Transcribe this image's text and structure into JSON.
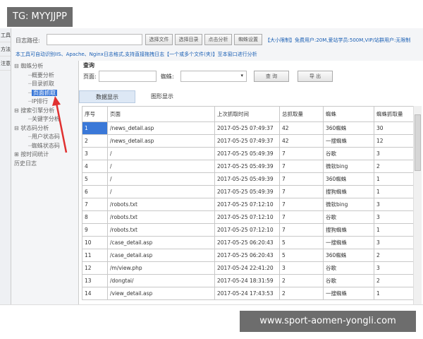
{
  "watermarks": {
    "top": "TG: MYYJJPP",
    "bottom": "www.sport-aomen-yongli.com"
  },
  "left_strip": [
    "工具/",
    "方法/",
    "注意事"
  ],
  "toolbar": {
    "log_path_label": "日志路径:",
    "log_path_value": "",
    "select_file": "选择文件",
    "select_dir": "选择目录",
    "analyze": "点击分析",
    "spider_settings": "蜘蛛设置",
    "size_limit": "【大小限制】免费用户:20M,爱站学员:500M,VIP/站群用户:无限制"
  },
  "info_text": "本工具可自动识别IIS、Apache、Nginx日志格式,支持直接拖拽日志【一个或多个文件(夹)】至本窗口进行分析",
  "tree": [
    {
      "label": "蜘蛛分析",
      "level": 0,
      "sign": "⊟"
    },
    {
      "label": "概要分析",
      "level": 1
    },
    {
      "label": "目录抓取",
      "level": 1
    },
    {
      "label": "页面抓取",
      "level": 1,
      "selected": true
    },
    {
      "label": "IP排行",
      "level": 1
    },
    {
      "label": "搜索引擎分析",
      "level": 0,
      "sign": "⊟"
    },
    {
      "label": "关键字分析",
      "level": 1
    },
    {
      "label": "状态码分析",
      "level": 0,
      "sign": "⊟"
    },
    {
      "label": "用户状态码",
      "level": 1
    },
    {
      "label": "蜘蛛状态码",
      "level": 1
    },
    {
      "label": "按时间统计",
      "level": 0,
      "sign": "⊞"
    },
    {
      "label": "历史日志",
      "level": 0
    }
  ],
  "query": {
    "title": "查询",
    "page_label": "页面:",
    "page_value": "",
    "spider_label": "蜘蛛:",
    "spider_value": "",
    "search_btn": "查 询",
    "export_btn": "导 出"
  },
  "tabs": [
    {
      "label": "数据显示",
      "active": true
    },
    {
      "label": "图形显示",
      "active": false
    }
  ],
  "table": {
    "headers": [
      "序号",
      "页面",
      "上次抓取时间",
      "总抓取量",
      "蜘蛛",
      "蜘蛛抓取量"
    ],
    "rows": [
      [
        "1",
        "/news_detail.asp",
        "2017-05-25 07:49:37",
        "42",
        "360蜘蛛",
        "30"
      ],
      [
        "2",
        "/news_detail.asp",
        "2017-05-25 07:49:37",
        "42",
        "一搜蜘蛛",
        "12"
      ],
      [
        "3",
        "/",
        "2017-05-25 05:49:39",
        "7",
        "谷歌",
        "3"
      ],
      [
        "4",
        "/",
        "2017-05-25 05:49:39",
        "7",
        "微软bing",
        "2"
      ],
      [
        "5",
        "/",
        "2017-05-25 05:49:39",
        "7",
        "360蜘蛛",
        "1"
      ],
      [
        "6",
        "/",
        "2017-05-25 05:49:39",
        "7",
        "搜狗蜘蛛",
        "1"
      ],
      [
        "7",
        "/robots.txt",
        "2017-05-25 07:12:10",
        "7",
        "微软bing",
        "3"
      ],
      [
        "8",
        "/robots.txt",
        "2017-05-25 07:12:10",
        "7",
        "谷歌",
        "3"
      ],
      [
        "9",
        "/robots.txt",
        "2017-05-25 07:12:10",
        "7",
        "搜狗蜘蛛",
        "1"
      ],
      [
        "10",
        "/case_detail.asp",
        "2017-05-25 06:20:43",
        "5",
        "一搜蜘蛛",
        "3"
      ],
      [
        "11",
        "/case_detail.asp",
        "2017-05-25 06:20:43",
        "5",
        "360蜘蛛",
        "2"
      ],
      [
        "12",
        "/m/view.php",
        "2017-05-24 22:41:20",
        "3",
        "谷歌",
        "3"
      ],
      [
        "13",
        "/dongtai/",
        "2017-05-24 18:31:59",
        "2",
        "谷歌",
        "2"
      ],
      [
        "14",
        "/view_detail.asp",
        "2017-05-24 17:43:53",
        "2",
        "一搜蜘蛛",
        "1"
      ]
    ]
  },
  "colors": {
    "accent": "#3a78d8",
    "link": "#1a5fb4",
    "arrow": "#e03030"
  }
}
